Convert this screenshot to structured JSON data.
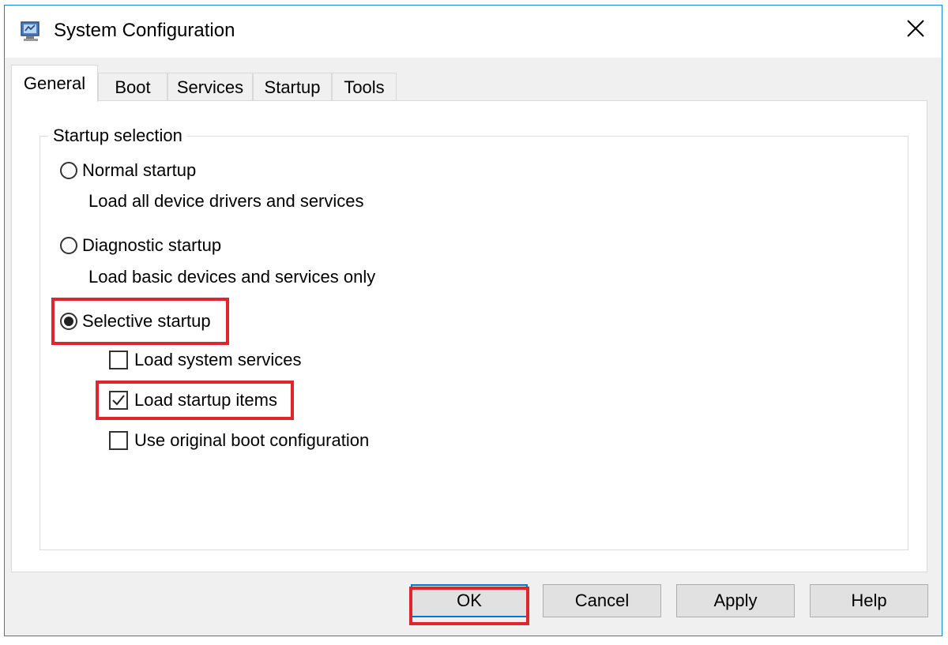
{
  "window": {
    "title": "System Configuration",
    "icon": "msconfig-icon",
    "close_icon": "close-icon",
    "accent_color": "#1883d7"
  },
  "tabs": [
    {
      "label": "General",
      "active": true
    },
    {
      "label": "Boot",
      "active": false
    },
    {
      "label": "Services",
      "active": false
    },
    {
      "label": "Startup",
      "active": false
    },
    {
      "label": "Tools",
      "active": false
    }
  ],
  "general": {
    "group_title": "Startup selection",
    "options": [
      {
        "label": "Normal startup",
        "description": "Load all device drivers and services",
        "selected": false
      },
      {
        "label": "Diagnostic startup",
        "description": "Load basic devices and services only",
        "selected": false
      },
      {
        "label": "Selective startup",
        "selected": true
      }
    ],
    "selective_items": [
      {
        "label": "Load system services",
        "checked": false
      },
      {
        "label": "Load startup items",
        "checked": true
      },
      {
        "label": "Use original boot configuration",
        "checked": false
      }
    ]
  },
  "buttons": {
    "ok": "OK",
    "cancel": "Cancel",
    "apply": "Apply",
    "help": "Help"
  },
  "highlight_color": "#e0262b"
}
